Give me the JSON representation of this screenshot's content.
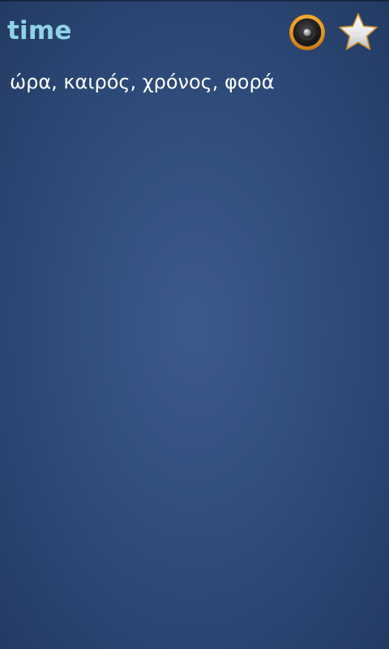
{
  "word": {
    "title": "time",
    "translation": "ώρα, καιρός, χρόνος, φορά"
  },
  "toolbar": {
    "speaker_icon": "speaker-icon",
    "favorite_icon": "star-icon"
  },
  "colors": {
    "title": "#8fd3e8",
    "background": "#33507f",
    "speaker_ring": "#f0a020",
    "star": "#e8e8e8"
  }
}
